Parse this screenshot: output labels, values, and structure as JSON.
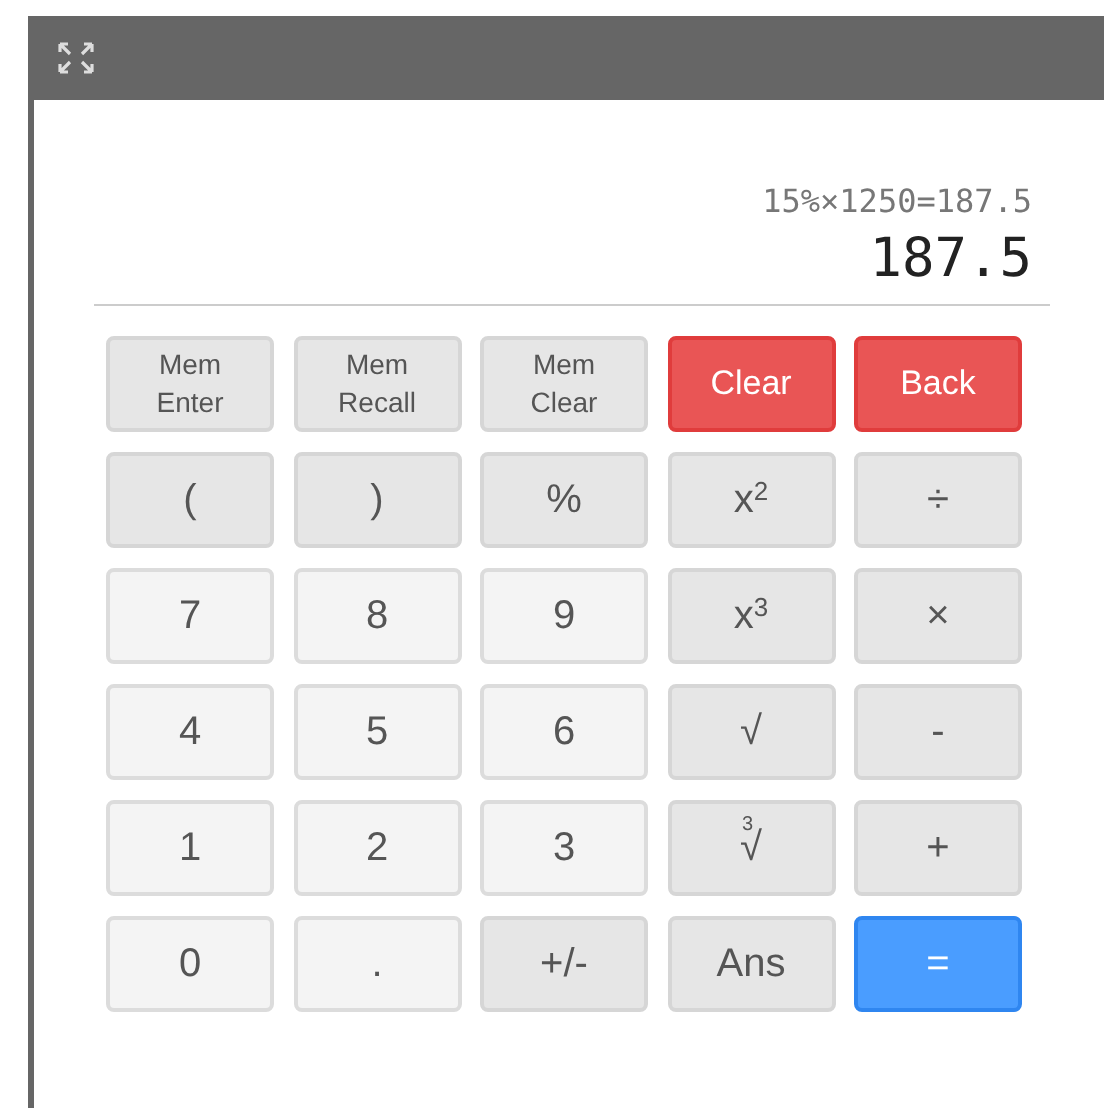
{
  "display": {
    "expression": "15%×1250=187.5",
    "result": "187.5"
  },
  "keys": [
    {
      "kind": "memory",
      "label": "Mem Enter"
    },
    {
      "kind": "memory",
      "label": "Mem Recall"
    },
    {
      "kind": "memory",
      "label": "Mem Clear"
    },
    {
      "kind": "danger",
      "label": "Clear"
    },
    {
      "kind": "danger",
      "label": "Back"
    },
    {
      "kind": "op",
      "label": "("
    },
    {
      "kind": "op",
      "label": ")"
    },
    {
      "kind": "op",
      "label": "%"
    },
    {
      "kind": "power",
      "label": "x",
      "exponent": "2"
    },
    {
      "kind": "op",
      "label": "÷"
    },
    {
      "kind": "digit",
      "label": "7"
    },
    {
      "kind": "digit",
      "label": "8"
    },
    {
      "kind": "digit",
      "label": "9"
    },
    {
      "kind": "power",
      "label": "x",
      "exponent": "3"
    },
    {
      "kind": "op",
      "label": "×"
    },
    {
      "kind": "digit",
      "label": "4"
    },
    {
      "kind": "digit",
      "label": "5"
    },
    {
      "kind": "digit",
      "label": "6"
    },
    {
      "kind": "op",
      "label": "√"
    },
    {
      "kind": "op",
      "label": "-"
    },
    {
      "kind": "digit",
      "label": "1"
    },
    {
      "kind": "digit",
      "label": "2"
    },
    {
      "kind": "digit",
      "label": "3"
    },
    {
      "kind": "root",
      "label": "√",
      "index": "3"
    },
    {
      "kind": "op",
      "label": "+"
    },
    {
      "kind": "digit",
      "label": "0"
    },
    {
      "kind": "digit",
      "label": "."
    },
    {
      "kind": "op",
      "label": "+/-"
    },
    {
      "kind": "op",
      "label": "Ans"
    },
    {
      "kind": "primary",
      "label": "="
    }
  ]
}
